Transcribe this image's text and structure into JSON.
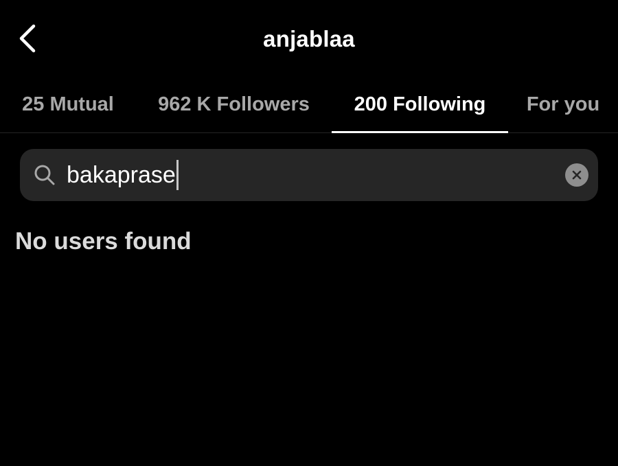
{
  "header": {
    "back_icon": "chevron-left-icon",
    "title": "anjablaa"
  },
  "tabs": [
    {
      "label": "25 Mutual",
      "active": false
    },
    {
      "label": "962 K Followers",
      "active": false
    },
    {
      "label": "200 Following",
      "active": true
    },
    {
      "label": "For you",
      "active": false
    }
  ],
  "search": {
    "icon": "search-icon",
    "value": "bakaprase",
    "clear_icon": "clear-icon"
  },
  "results": {
    "empty_message": "No users found"
  },
  "colors": {
    "background": "#000000",
    "text_primary": "#ffffff",
    "text_inactive": "#a8a8a8",
    "search_field": "#262626",
    "clear_button": "#8e8e8e"
  }
}
